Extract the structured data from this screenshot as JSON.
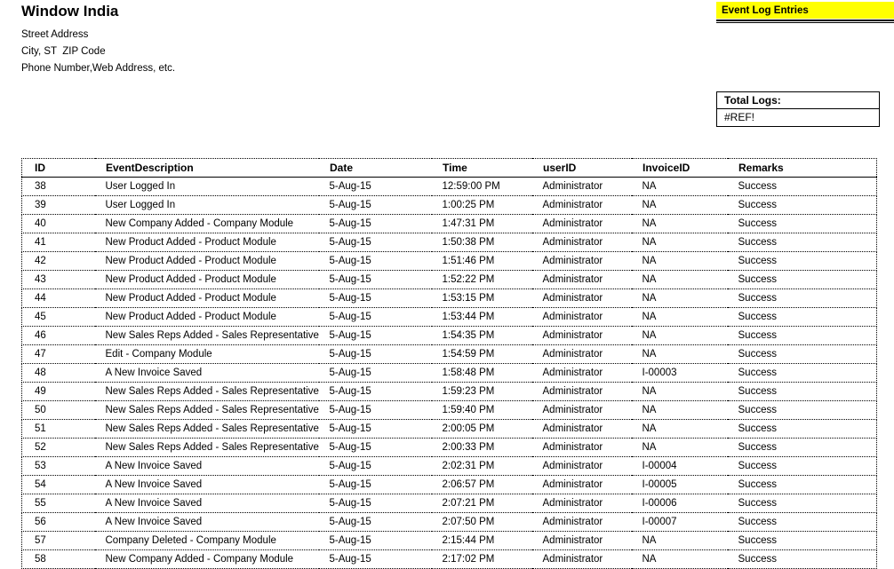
{
  "company": {
    "name": "Window India",
    "lines": [
      "Street Address",
      "City, ST  ZIP Code",
      "Phone Number,Web Address, etc."
    ]
  },
  "banner": {
    "title": "Event Log Entries",
    "background_color": "#FFFF00"
  },
  "total_logs": {
    "label": "Total Logs:",
    "value": "#REF!"
  },
  "log_table": {
    "columns": [
      "ID",
      "EventDescription",
      "Date",
      "Time",
      "userID",
      "InvoiceID",
      "Remarks"
    ],
    "rows": [
      [
        "38",
        "User Logged In",
        "5-Aug-15",
        "12:59:00 PM",
        "Administrator",
        "NA",
        "Success"
      ],
      [
        "39",
        "User Logged In",
        "5-Aug-15",
        "1:00:25 PM",
        "Administrator",
        "NA",
        "Success"
      ],
      [
        "40",
        "New Company Added - Company Module",
        "5-Aug-15",
        "1:47:31 PM",
        "Administrator",
        "NA",
        "Success"
      ],
      [
        "41",
        "New Product Added - Product Module",
        "5-Aug-15",
        "1:50:38 PM",
        "Administrator",
        "NA",
        "Success"
      ],
      [
        "42",
        "New Product Added - Product Module",
        "5-Aug-15",
        "1:51:46 PM",
        "Administrator",
        "NA",
        "Success"
      ],
      [
        "43",
        "New Product Added - Product Module",
        "5-Aug-15",
        "1:52:22 PM",
        "Administrator",
        "NA",
        "Success"
      ],
      [
        "44",
        "New Product Added - Product Module",
        "5-Aug-15",
        "1:53:15 PM",
        "Administrator",
        "NA",
        "Success"
      ],
      [
        "45",
        "New Product Added - Product Module",
        "5-Aug-15",
        "1:53:44 PM",
        "Administrator",
        "NA",
        "Success"
      ],
      [
        "46",
        "New Sales Reps Added - Sales Representative Module",
        "5-Aug-15",
        "1:54:35 PM",
        "Administrator",
        "NA",
        "Success"
      ],
      [
        "47",
        "Edit - Company Module",
        "5-Aug-15",
        "1:54:59 PM",
        "Administrator",
        "NA",
        "Success"
      ],
      [
        "48",
        "A New Invoice Saved",
        "5-Aug-15",
        "1:58:48 PM",
        "Administrator",
        "I-00003",
        "Success"
      ],
      [
        "49",
        "New Sales Reps Added - Sales Representative Module",
        "5-Aug-15",
        "1:59:23 PM",
        "Administrator",
        "NA",
        "Success"
      ],
      [
        "50",
        "New Sales Reps Added - Sales Representative Module",
        "5-Aug-15",
        "1:59:40 PM",
        "Administrator",
        "NA",
        "Success"
      ],
      [
        "51",
        "New Sales Reps Added - Sales Representative Module",
        "5-Aug-15",
        "2:00:05 PM",
        "Administrator",
        "NA",
        "Success"
      ],
      [
        "52",
        "New Sales Reps Added - Sales Representative Module",
        "5-Aug-15",
        "2:00:33 PM",
        "Administrator",
        "NA",
        "Success"
      ],
      [
        "53",
        "A New Invoice Saved",
        "5-Aug-15",
        "2:02:31 PM",
        "Administrator",
        "I-00004",
        "Success"
      ],
      [
        "54",
        "A New Invoice Saved",
        "5-Aug-15",
        "2:06:57 PM",
        "Administrator",
        "I-00005",
        "Success"
      ],
      [
        "55",
        "A New Invoice Saved",
        "5-Aug-15",
        "2:07:21 PM",
        "Administrator",
        "I-00006",
        "Success"
      ],
      [
        "56",
        "A New Invoice Saved",
        "5-Aug-15",
        "2:07:50 PM",
        "Administrator",
        "I-00007",
        "Success"
      ],
      [
        "57",
        "Company Deleted - Company Module",
        "5-Aug-15",
        "2:15:44 PM",
        "Administrator",
        "NA",
        "Success"
      ],
      [
        "58",
        "New Company Added - Company Module",
        "5-Aug-15",
        "2:17:02 PM",
        "Administrator",
        "NA",
        "Success"
      ]
    ]
  }
}
